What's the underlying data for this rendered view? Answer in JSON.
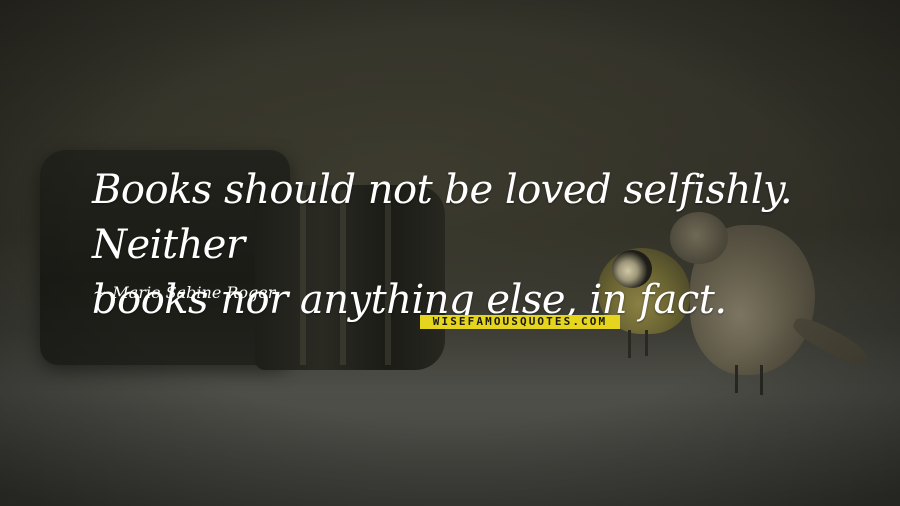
{
  "quote": {
    "line1": "Books should not be loved selfishly. Neither",
    "line2": "books nor anything else, in fact."
  },
  "author": {
    "prefix": "~",
    "name": "Marie Sabine Roger"
  },
  "watermark": {
    "text": "WISEFAMOUSQUOTES.COM",
    "bg_color": "#e6d51e"
  },
  "colors": {
    "text": "#ffffff",
    "background": "#2c2b22"
  }
}
